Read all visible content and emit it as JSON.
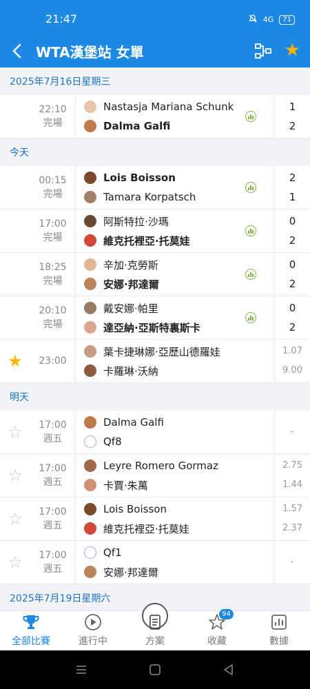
{
  "status": {
    "time": "21:47",
    "battery": "71",
    "signal": "4G"
  },
  "header": {
    "title": "WTA漢堡站 女單",
    "back_icon": "chevron-left-icon",
    "bracket_icon": "bracket-icon",
    "favorite_icon": "star-icon"
  },
  "colors": {
    "primary": "#1e88e5",
    "accent": "#ffb300",
    "stats": "#7cb342"
  },
  "sections": [
    {
      "date": "2025年7月16日星期三",
      "matches": [
        {
          "time": "22:10",
          "status": "完場",
          "starred": null,
          "stats": true,
          "players": [
            {
              "name": "Nastasja Mariana Schunk",
              "winner": false,
              "avatar": "#e8c4a8"
            },
            {
              "name": "Dalma Galfi",
              "winner": true,
              "avatar": "#c07a4a"
            }
          ],
          "scores": [
            "1",
            "2"
          ],
          "odds": false
        }
      ]
    },
    {
      "date": "今天",
      "matches": [
        {
          "time": "00:15",
          "status": "完場",
          "starred": null,
          "stats": true,
          "players": [
            {
              "name": "Lois Boisson",
              "winner": true,
              "avatar": "#7a4a2a"
            },
            {
              "name": "Tamara Korpatsch",
              "winner": false,
              "avatar": "#a0826a"
            }
          ],
          "scores": [
            "2",
            "1"
          ],
          "odds": false
        },
        {
          "time": "17:00",
          "status": "完場",
          "starred": null,
          "stats": true,
          "players": [
            {
              "name": "阿斯特拉·沙瑪",
              "winner": false,
              "avatar": "#6b4a32"
            },
            {
              "name": "維克托裡亞·托莫娃",
              "winner": true,
              "avatar": "#d04a3a"
            }
          ],
          "scores": [
            "0",
            "2"
          ],
          "odds": false
        },
        {
          "time": "18:25",
          "status": "完場",
          "starred": null,
          "stats": true,
          "players": [
            {
              "name": "辛加·克勞斯",
              "winner": false,
              "avatar": "#e0b898"
            },
            {
              "name": "安娜·邦達爾",
              "winner": true,
              "avatar": "#b8865a"
            }
          ],
          "scores": [
            "0",
            "2"
          ],
          "odds": false
        },
        {
          "time": "20:10",
          "status": "完場",
          "starred": null,
          "stats": true,
          "players": [
            {
              "name": "戴安娜·帕里",
              "winner": false,
              "avatar": "#9a7a62"
            },
            {
              "name": "達亞納·亞斯特裏斯卡",
              "winner": true,
              "avatar": "#d8a890"
            }
          ],
          "scores": [
            "0",
            "2"
          ],
          "odds": false
        },
        {
          "time": "23:00",
          "status": "",
          "starred": true,
          "stats": false,
          "players": [
            {
              "name": "葉卡捷琳娜·亞歷山德羅娃",
              "winner": false,
              "avatar": "#c89c84"
            },
            {
              "name": "卡羅琳·沃納",
              "winner": false,
              "avatar": "#8a5a3a"
            }
          ],
          "scores": [
            "1.07",
            "9.00"
          ],
          "odds": true
        }
      ]
    },
    {
      "date": "明天",
      "matches": [
        {
          "time": "17:00",
          "status": "週五",
          "starred": false,
          "stats": false,
          "players": [
            {
              "name": "Dalma Galfi",
              "winner": false,
              "avatar": "#c07a4a"
            },
            {
              "name": "Qf8",
              "winner": false,
              "avatar": "placeholder"
            }
          ],
          "scores": [
            "-"
          ],
          "odds": true
        },
        {
          "time": "17:00",
          "status": "週五",
          "starred": false,
          "stats": false,
          "players": [
            {
              "name": "Leyre Romero Gormaz",
              "winner": false,
              "avatar": "#a06848"
            },
            {
              "name": "卡賈·朱萬",
              "winner": false,
              "avatar": "#d09070"
            }
          ],
          "scores": [
            "2.75",
            "1.44"
          ],
          "odds": true
        },
        {
          "time": "17:00",
          "status": "週五",
          "starred": false,
          "stats": false,
          "players": [
            {
              "name": "Lois Boisson",
              "winner": false,
              "avatar": "#7a4a2a"
            },
            {
              "name": "維克托裡亞·托莫娃",
              "winner": false,
              "avatar": "#d04a3a"
            }
          ],
          "scores": [
            "1.57",
            "2.37"
          ],
          "odds": true
        },
        {
          "time": "17:00",
          "status": "週五",
          "starred": false,
          "stats": false,
          "players": [
            {
              "name": "Qf1",
              "winner": false,
              "avatar": "placeholder"
            },
            {
              "name": "安娜·邦達爾",
              "winner": false,
              "avatar": "#b8865a"
            }
          ],
          "scores": [
            "-"
          ],
          "odds": true
        }
      ]
    },
    {
      "date": "2025年7月19日星期六",
      "matches": []
    }
  ],
  "nav": [
    {
      "label": "全部比賽",
      "icon": "trophy-icon",
      "active": true
    },
    {
      "label": "進行中",
      "icon": "play-icon",
      "active": false
    },
    {
      "label": "方案",
      "icon": "plan-icon",
      "active": false
    },
    {
      "label": "收藏",
      "icon": "star-outline-icon",
      "active": false,
      "badge": "94"
    },
    {
      "label": "數據",
      "icon": "chart-icon",
      "active": false
    }
  ]
}
